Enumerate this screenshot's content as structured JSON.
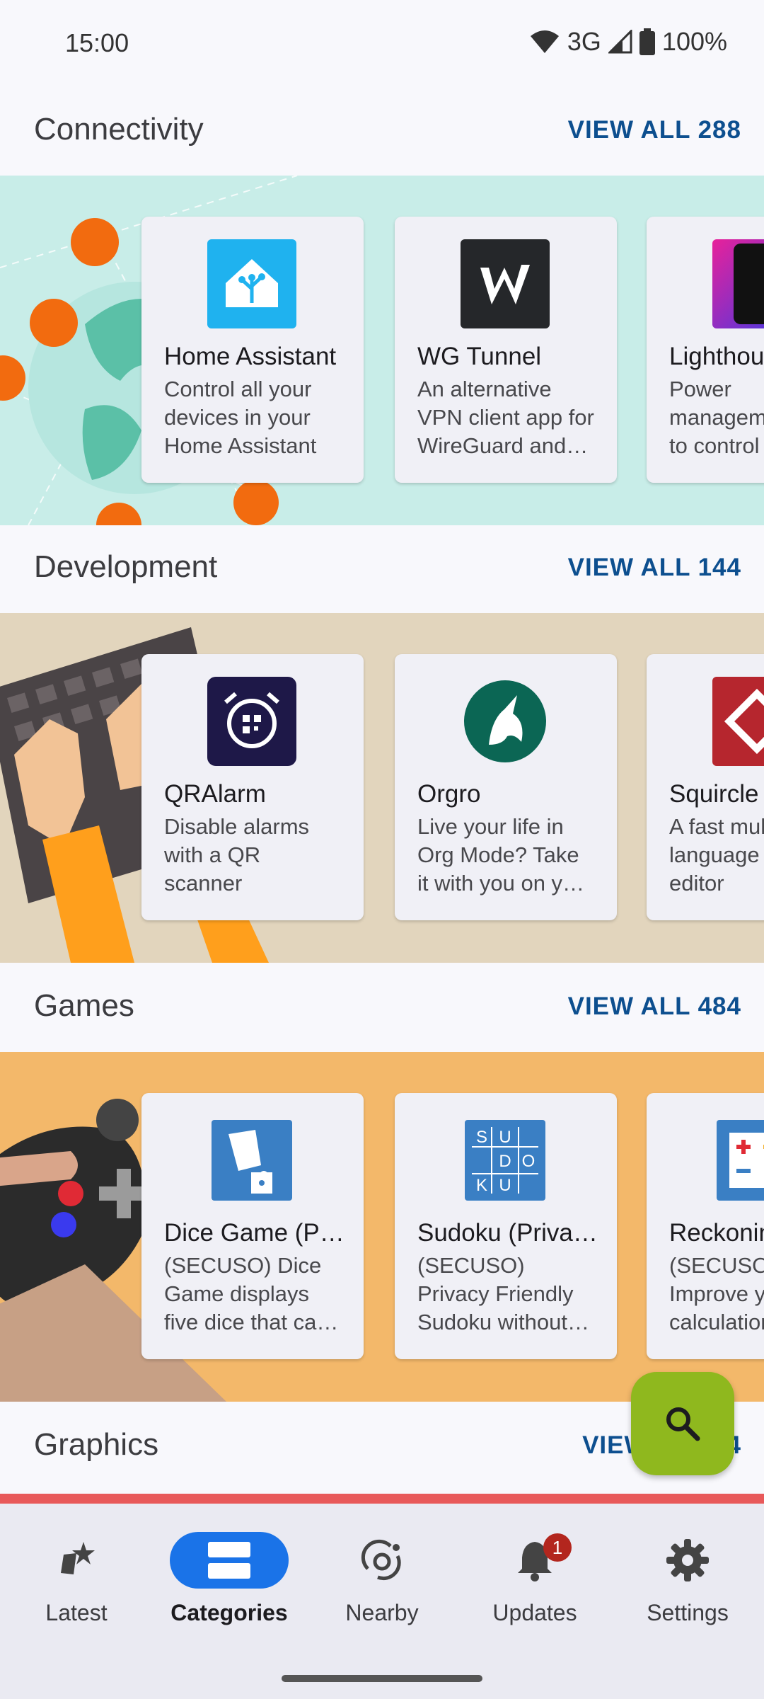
{
  "status_bar": {
    "time": "15:00",
    "network": "3G",
    "battery": "100%"
  },
  "sections": [
    {
      "title": "Connectivity",
      "view_all": "VIEW ALL 288",
      "apps": [
        {
          "name": "Home Assistant",
          "desc": "Control all your devices in your Home Assistant"
        },
        {
          "name": "WG Tunnel",
          "desc": "An alternative VPN client app for WireGuard and AmneziaWG"
        },
        {
          "name": "Lighthouse",
          "desc": "Power management app to control"
        }
      ]
    },
    {
      "title": "Development",
      "view_all": "VIEW ALL 144",
      "apps": [
        {
          "name": "QRAlarm",
          "desc": "Disable alarms with a QR scanner"
        },
        {
          "name": "Orgro",
          "desc": "Live your life in Org Mode? Take it with you on your phone"
        },
        {
          "name": "Squircle",
          "desc": "A fast multi-language code editor"
        }
      ]
    },
    {
      "title": "Games",
      "view_all": "VIEW ALL 484",
      "apps": [
        {
          "name": "Dice Game (Privacy Friendly)",
          "desc": "(SECUSO) Dice Game displays five dice that can be rolled"
        },
        {
          "name": "Sudoku (Privacy Friendly)",
          "desc": "(SECUSO) Privacy Friendly Sudoku without ads"
        },
        {
          "name": "Reckoning Skills",
          "desc": "(SECUSO) Improve your calculation skills"
        }
      ]
    },
    {
      "title": "Graphics",
      "view_all": "VIEW ALL 84"
    }
  ],
  "sudoku_icon_letters": [
    "S",
    "U",
    "D",
    "O",
    "K",
    "U"
  ],
  "nav": {
    "items": [
      {
        "label": "Latest"
      },
      {
        "label": "Categories"
      },
      {
        "label": "Nearby"
      },
      {
        "label": "Updates",
        "badge": "1"
      },
      {
        "label": "Settings"
      }
    ],
    "active": "Categories"
  },
  "colors": {
    "accent": "#0d4f8f",
    "fab": "#8fb81e",
    "active_pill": "#1a73e8",
    "connectivity_bg": "#c8ede8",
    "development_bg": "#e2d5bd",
    "games_bg": "#f3b86a"
  }
}
